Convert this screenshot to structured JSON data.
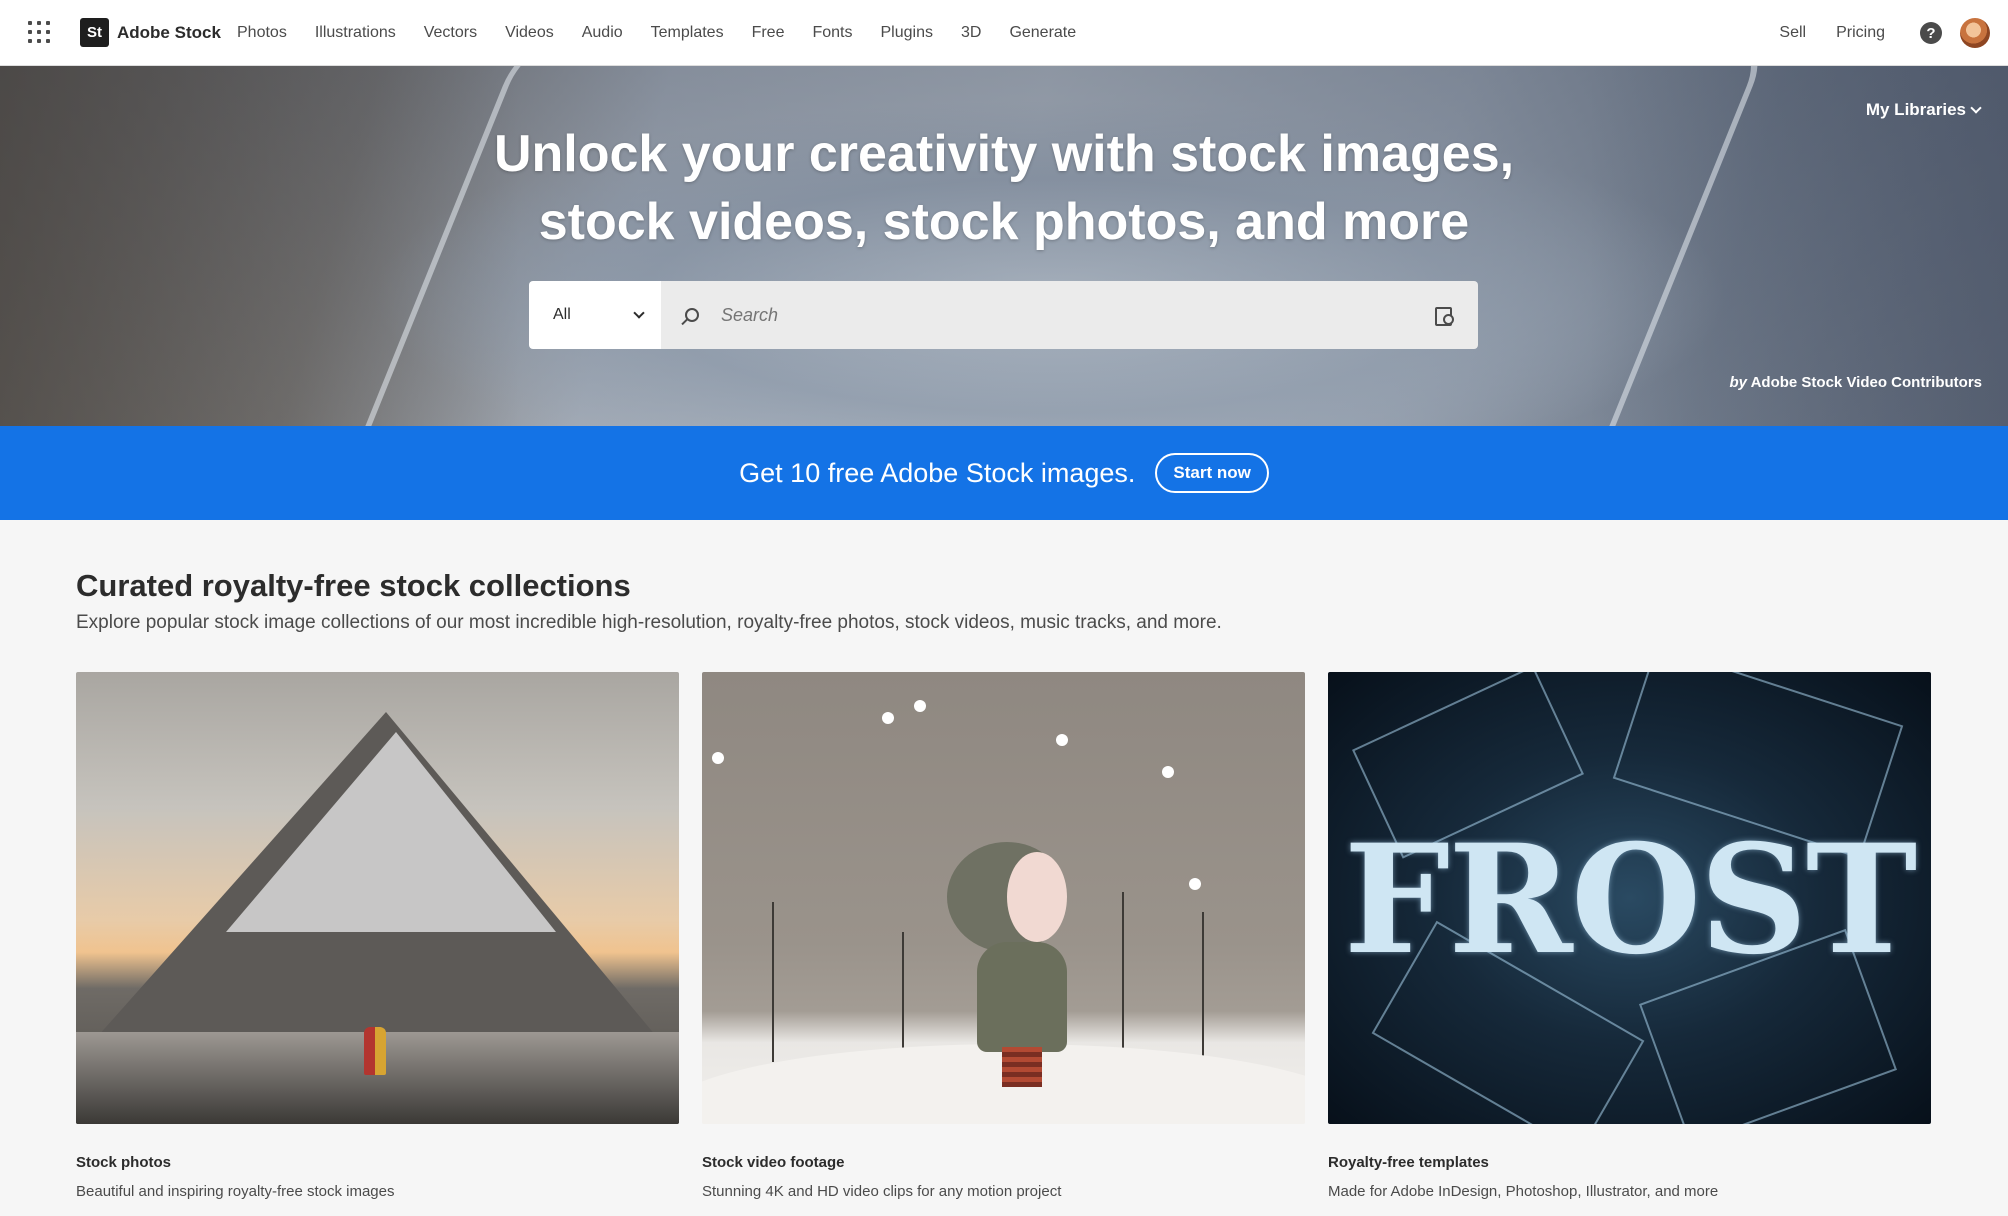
{
  "brand": {
    "logo_text": "St",
    "name": "Adobe Stock"
  },
  "nav": {
    "items": [
      "Photos",
      "Illustrations",
      "Vectors",
      "Videos",
      "Audio",
      "Templates",
      "Free",
      "Fonts",
      "Plugins",
      "3D",
      "Generate"
    ],
    "right": {
      "sell": "Sell",
      "pricing": "Pricing",
      "help_glyph": "?"
    }
  },
  "hero": {
    "title": "Unlock your creativity with stock images, stock videos, stock photos, and more",
    "my_libraries": "My Libraries",
    "search": {
      "category": "All",
      "placeholder": "Search"
    },
    "credit_by": "by",
    "credit": "Adobe Stock Video Contributors"
  },
  "promo": {
    "text": "Get 10 free Adobe Stock images.",
    "button": "Start now",
    "color": "#1473e6"
  },
  "collections": {
    "title": "Curated royalty-free stock collections",
    "subtitle": "Explore popular stock image collections of our most incredible high-resolution, royalty-free photos, stock videos, music tracks, and more.",
    "cards": [
      {
        "title": "Stock photos",
        "description": "Beautiful and inspiring royalty-free stock images"
      },
      {
        "title": "Stock video footage",
        "description": "Stunning 4K and HD video clips for any motion project"
      },
      {
        "title": "Royalty-free templates",
        "description": "Made for Adobe InDesign, Photoshop, Illustrator, and more",
        "image_text": "FROST"
      }
    ]
  },
  "icons": [
    "apps-grid-icon",
    "chevron-down-icon",
    "search-icon",
    "visual-search-icon",
    "help-icon"
  ]
}
